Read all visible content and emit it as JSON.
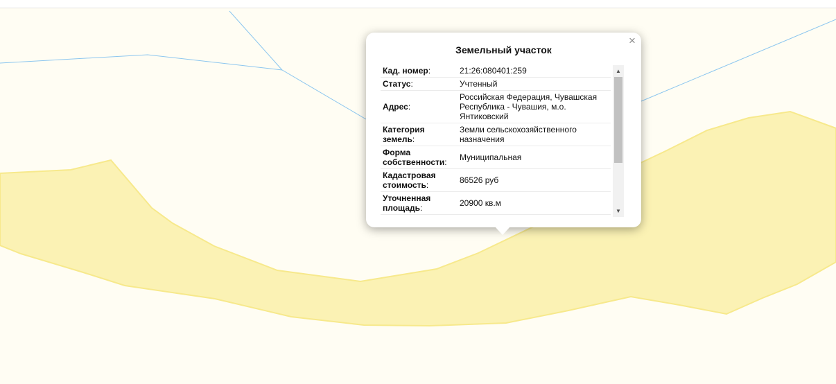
{
  "map": {
    "colors": {
      "background": "#fffdf3",
      "parcel_fill": "#fbf2b4",
      "parcel_stroke": "#f7e98c",
      "boundary_line": "#8cc6ef"
    }
  },
  "popup": {
    "title": "Земельный участок",
    "close_icon": "close-icon",
    "rows": [
      {
        "label": "Кад. номер",
        "value": "21:26:080401:259"
      },
      {
        "label": "Статус",
        "value": "Учтенный"
      },
      {
        "label": "Адрес",
        "value": "Российская Федерация, Чувашская Республика - Чувашия, м.о. Янтиковский"
      },
      {
        "label": "Категория земель",
        "value": "Земли сельскохозяйственного назначения"
      },
      {
        "label": "Форма собственности",
        "value": "Муниципальная"
      },
      {
        "label": "Кадастровая стоимость",
        "value": "86526 руб"
      },
      {
        "label": "Уточненная площадь",
        "value": "20900 кв.м"
      }
    ],
    "scroll_position": 0.0
  }
}
